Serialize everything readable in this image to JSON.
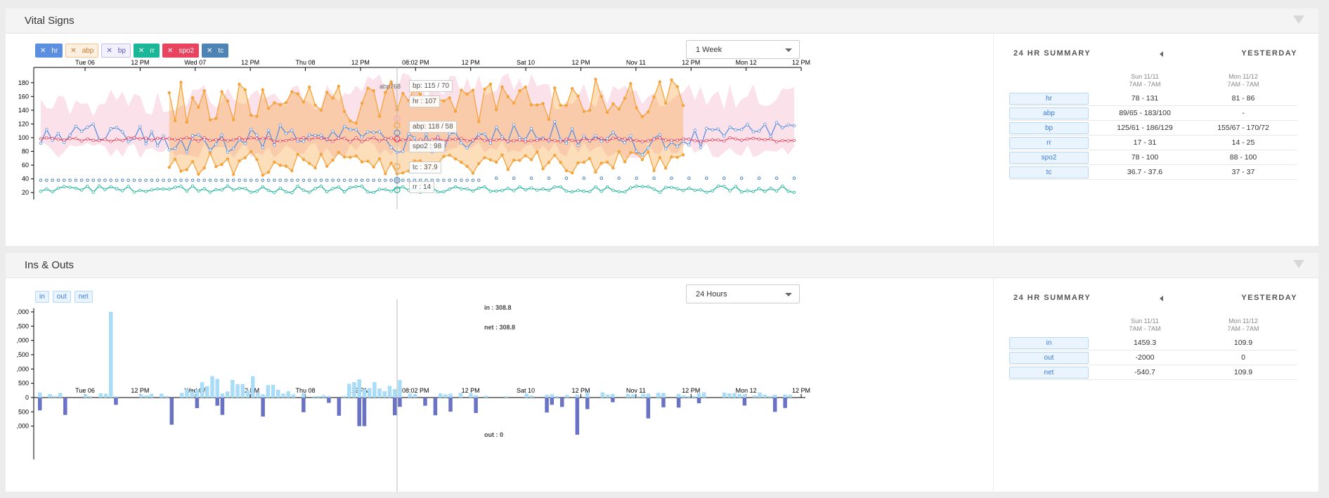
{
  "vitals": {
    "title": "Vital Signs",
    "chips": [
      {
        "key": "hr",
        "label": "hr"
      },
      {
        "key": "abp",
        "label": "abp"
      },
      {
        "key": "bp",
        "label": "bp"
      },
      {
        "key": "rr",
        "label": "rr"
      },
      {
        "key": "spo2",
        "label": "spo2"
      },
      {
        "key": "tc",
        "label": "tc"
      }
    ],
    "range_select": "1 Week",
    "x_ticks": [
      "Tue 06",
      "12 PM",
      "Wed 07",
      "12 PM",
      "Thu 08",
      "12 PM",
      "08:02 PM",
      "12 PM",
      "Sat 10",
      "12 PM",
      "Nov 11",
      "12 PM",
      "Mon 12",
      "12 PM"
    ],
    "y_ticks": [
      "20",
      "40",
      "60",
      "80",
      "100",
      "120",
      "140",
      "160",
      "180"
    ],
    "cursor_label": "08:02 PM",
    "tooltips": {
      "bp": "bp: 115 / 70",
      "hr": "hr : 107",
      "abp": "abp: 118 / 58",
      "spo2": "spo2 : 98",
      "tc": "tc : 37.9",
      "rr": "rr : 14",
      "overlap": "abp768"
    },
    "colors": {
      "hr": "#5b8fe0",
      "abp": "#f5a33a",
      "bp": "#f4a9c0",
      "rr": "#19b698",
      "spo2": "#e8435f",
      "tc": "#4e84b5"
    },
    "summary": {
      "heading": "24 HR SUMMARY",
      "yesterday": "YESTERDAY",
      "col1_date": "Sun 11/11",
      "col1_range": "7AM - 7AM",
      "col2_date": "Mon 11/12",
      "col2_range": "7AM - 7AM",
      "rows": [
        {
          "label": "hr",
          "v1": "78 - 131",
          "v2": "81 - 86"
        },
        {
          "label": "abp",
          "v1": "89/65 - 183/100",
          "v2": "-"
        },
        {
          "label": "bp",
          "v1": "125/61 - 186/129",
          "v2": "155/67 - 170/72"
        },
        {
          "label": "rr",
          "v1": "17 - 31",
          "v2": "14 - 25"
        },
        {
          "label": "spo2",
          "v1": "78 - 100",
          "v2": "88 - 100"
        },
        {
          "label": "tc",
          "v1": "36.7 - 37.6",
          "v2": "37 - 37"
        }
      ]
    }
  },
  "insouts": {
    "title": "Ins & Outs",
    "chips": [
      {
        "label": "in"
      },
      {
        "label": "out"
      },
      {
        "label": "net"
      }
    ],
    "range_select": "24 Hours",
    "y_ticks": [
      ",000",
      ",500",
      ",000",
      ",500",
      ",000",
      "500",
      "0",
      "500",
      ",000"
    ],
    "in_label": "in : 308.8",
    "net_label": "net : 308.8",
    "out_label": "out : 0",
    "colors": {
      "in": "#a8dcf7",
      "out": "#6a72c4"
    },
    "summary": {
      "heading": "24 HR SUMMARY",
      "yesterday": "YESTERDAY",
      "col1_date": "Sun 11/11",
      "col1_range": "7AM - 7AM",
      "col2_date": "Mon 11/12",
      "col2_range": "7AM - 7AM",
      "rows": [
        {
          "label": "in",
          "v1": "1459.3",
          "v2": "109.9"
        },
        {
          "label": "out",
          "v1": "-2000",
          "v2": "0"
        },
        {
          "label": "net",
          "v1": "-540.7",
          "v2": "109.9"
        }
      ]
    }
  }
}
